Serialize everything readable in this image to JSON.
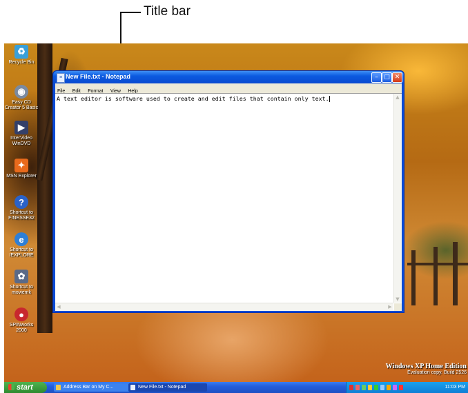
{
  "callout": {
    "label": "Title bar"
  },
  "desktop": {
    "icons": [
      {
        "name": "recycle-bin",
        "label": "Recycle Bin",
        "symbol": "♻",
        "color": "#3aa0d8"
      },
      {
        "name": "easy-cd-creator",
        "label": "Easy CD\nCreator 5 Basic",
        "symbol": "◉",
        "color": "#7a8aa0"
      },
      {
        "name": "intervideo-windvd",
        "label": "InterVideo\nWinDVD",
        "symbol": "▶",
        "color": "#34406a"
      },
      {
        "name": "msn-explorer",
        "label": "MSN Explorer",
        "symbol": "✦",
        "color": "#e86a1c"
      },
      {
        "name": "shortcut-finesse32",
        "label": "Shortcut to\nFINESSE32",
        "symbol": "?",
        "color": "#2a62c8"
      },
      {
        "name": "shortcut-iexplore",
        "label": "Shortcut to\nIEXPLORE",
        "symbol": "e",
        "color": "#2e7fd6"
      },
      {
        "name": "shortcut-moviemk",
        "label": "Shortcut to\nmoviemk",
        "symbol": "✿",
        "color": "#5a6a88"
      },
      {
        "name": "spinworks-2000",
        "label": "SPINworks\n2000",
        "symbol": "●",
        "color": "#c8282e"
      }
    ],
    "watermark": {
      "line1": "Windows XP Home Edition",
      "line2": "Evaluation copy. Build 2526"
    }
  },
  "window": {
    "title": "New File.txt - Notepad",
    "menu": [
      "File",
      "Edit",
      "Format",
      "View",
      "Help"
    ],
    "content": "A text editor is software used to create and edit files that contain only text."
  },
  "taskbar": {
    "start_label": "start",
    "tasks": [
      {
        "label": "Address Bar on My C..."
      },
      {
        "label": "New File.txt - Notepad"
      }
    ],
    "clock": "11:03 PM"
  }
}
